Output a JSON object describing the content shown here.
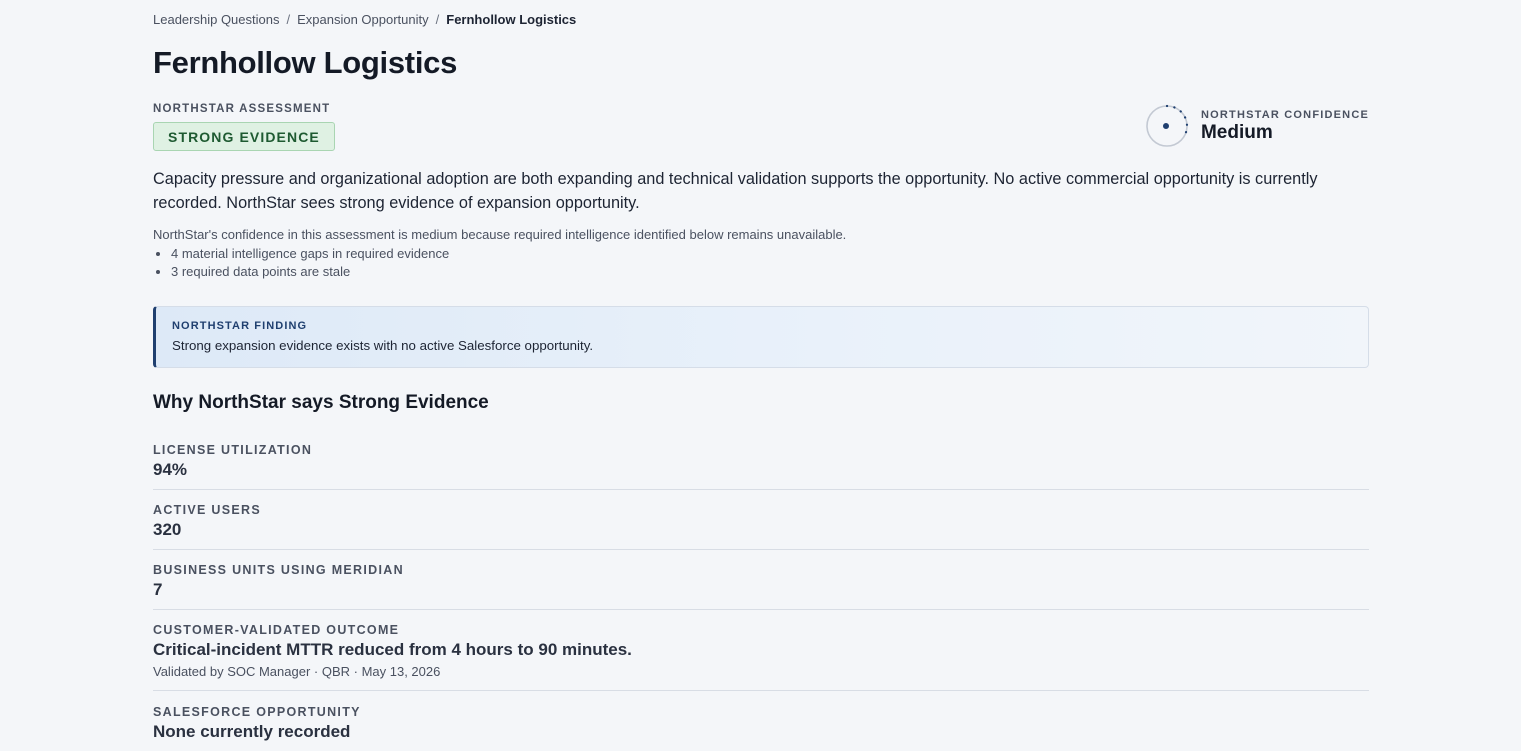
{
  "breadcrumb": {
    "items": [
      "Leadership Questions",
      "Expansion Opportunity"
    ],
    "current": "Fernhollow Logistics",
    "separator": "/"
  },
  "page_title": "Fernhollow Logistics",
  "assessment": {
    "label": "NORTHSTAR ASSESSMENT",
    "badge": "STRONG EVIDENCE",
    "badge_colors": {
      "bg": "#dff1e3",
      "border": "#a9d5b2",
      "text": "#1e5a31"
    }
  },
  "confidence": {
    "label": "NORTHSTAR CONFIDENCE",
    "value": "Medium",
    "icon": "confidence-ring-icon"
  },
  "summary": "Capacity pressure and organizational adoption are both expanding and technical validation supports the opportunity. No active commercial opportunity is currently recorded. NorthStar sees strong evidence of expansion opportunity.",
  "confidence_note": "NorthStar's confidence in this assessment is medium because required intelligence identified below remains unavailable.",
  "gaps": [
    "4 material intelligence gaps in required evidence",
    "3 required data points are stale"
  ],
  "finding": {
    "label": "NORTHSTAR FINDING",
    "text": "Strong expansion evidence exists with no active Salesforce opportunity.",
    "accent": "#1f3f6f"
  },
  "why_heading": "Why NorthStar says Strong Evidence",
  "metrics": [
    {
      "label": "LICENSE UTILIZATION",
      "value": "94%"
    },
    {
      "label": "ACTIVE USERS",
      "value": "320"
    },
    {
      "label": "BUSINESS UNITS USING MERIDIAN",
      "value": "7"
    },
    {
      "label": "CUSTOMER-VALIDATED OUTCOME",
      "value": "Critical-incident MTTR reduced from 4 hours to 90 minutes.",
      "sub": "Validated by SOC Manager · QBR · May 13, 2026"
    },
    {
      "label": "SALESFORCE OPPORTUNITY",
      "value": "None currently recorded"
    }
  ]
}
